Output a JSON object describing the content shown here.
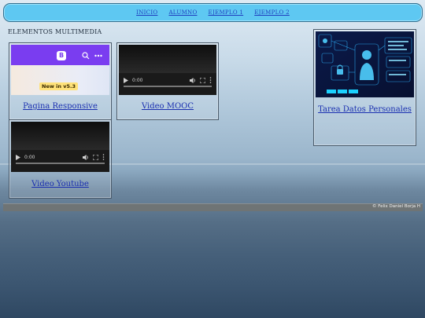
{
  "nav": {
    "items": [
      "INICIO",
      "ALUMNO",
      "EJEMPLO 1",
      "EJEMPLO 2"
    ]
  },
  "section": {
    "title": "ELEMENTOS MULTIMEDIA"
  },
  "cards": {
    "responsive": {
      "caption": "Pagina Responsive",
      "badge": "New in v5.3"
    },
    "mooc": {
      "caption": "Video MOOC",
      "time": "0:00"
    },
    "youtube": {
      "caption": "Video Youtube",
      "time": "0:00"
    },
    "datos": {
      "caption": "Tarea Datos Personales"
    }
  },
  "footer": {
    "credit": "© Felix Daniel Borja H"
  },
  "colors": {
    "nav_bg": "#5ec8f2",
    "link": "#1a2fb0",
    "bootstrap_purple": "#7a3df0"
  }
}
